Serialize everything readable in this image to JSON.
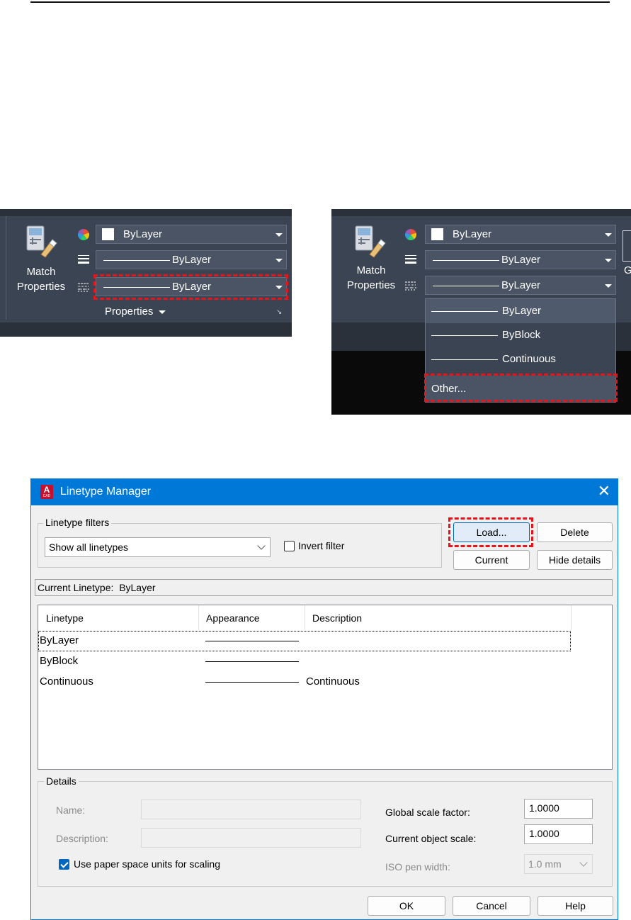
{
  "ribbon": {
    "match_properties": [
      "Match",
      "Properties"
    ],
    "color_combo": "ByLayer",
    "lineweight_combo": "ByLayer",
    "linetype_combo": "ByLayer",
    "panel_label": "Properties",
    "icons": [
      "match-properties-icon",
      "color-wheel-icon",
      "lineweight-icon",
      "linetype-icon",
      "chevron-down-icon",
      "dialog-launcher-icon"
    ],
    "highlight_color": "#e8141c"
  },
  "ribbon_open": {
    "match_properties": [
      "Match",
      "Properties"
    ],
    "color_combo": "ByLayer",
    "lineweight_combo": "ByLayer",
    "linetype_combo": "ByLayer",
    "dropdown_items": [
      "ByLayer",
      "ByBlock",
      "Continuous"
    ],
    "dropdown_other": "Other...",
    "cut_label": "G"
  },
  "dialog": {
    "title": "Linetype Manager",
    "filters_group": "Linetype filters",
    "filter_value": "Show all linetypes",
    "invert_filter": "Invert filter",
    "buttons": {
      "load": "Load...",
      "delete": "Delete",
      "current": "Current",
      "hide_details": "Hide details"
    },
    "current_linetype_label": "Current Linetype:",
    "current_linetype_value": "ByLayer",
    "columns": [
      "Linetype",
      "Appearance",
      "Description"
    ],
    "rows": [
      {
        "name": "ByLayer",
        "description": ""
      },
      {
        "name": "ByBlock",
        "description": ""
      },
      {
        "name": "Continuous",
        "description": "Continuous"
      }
    ],
    "details": {
      "group": "Details",
      "name_label": "Name:",
      "description_label": "Description:",
      "paper_space": "Use paper space units for scaling",
      "global_scale_label": "Global scale factor:",
      "global_scale_value": "1.0000",
      "current_scale_label": "Current object scale:",
      "current_scale_value": "1.0000",
      "iso_pen_label": "ISO pen width:",
      "iso_pen_value": "1.0 mm"
    },
    "footer": {
      "ok": "OK",
      "cancel": "Cancel",
      "help": "Help"
    },
    "accent": "#0078d7"
  }
}
